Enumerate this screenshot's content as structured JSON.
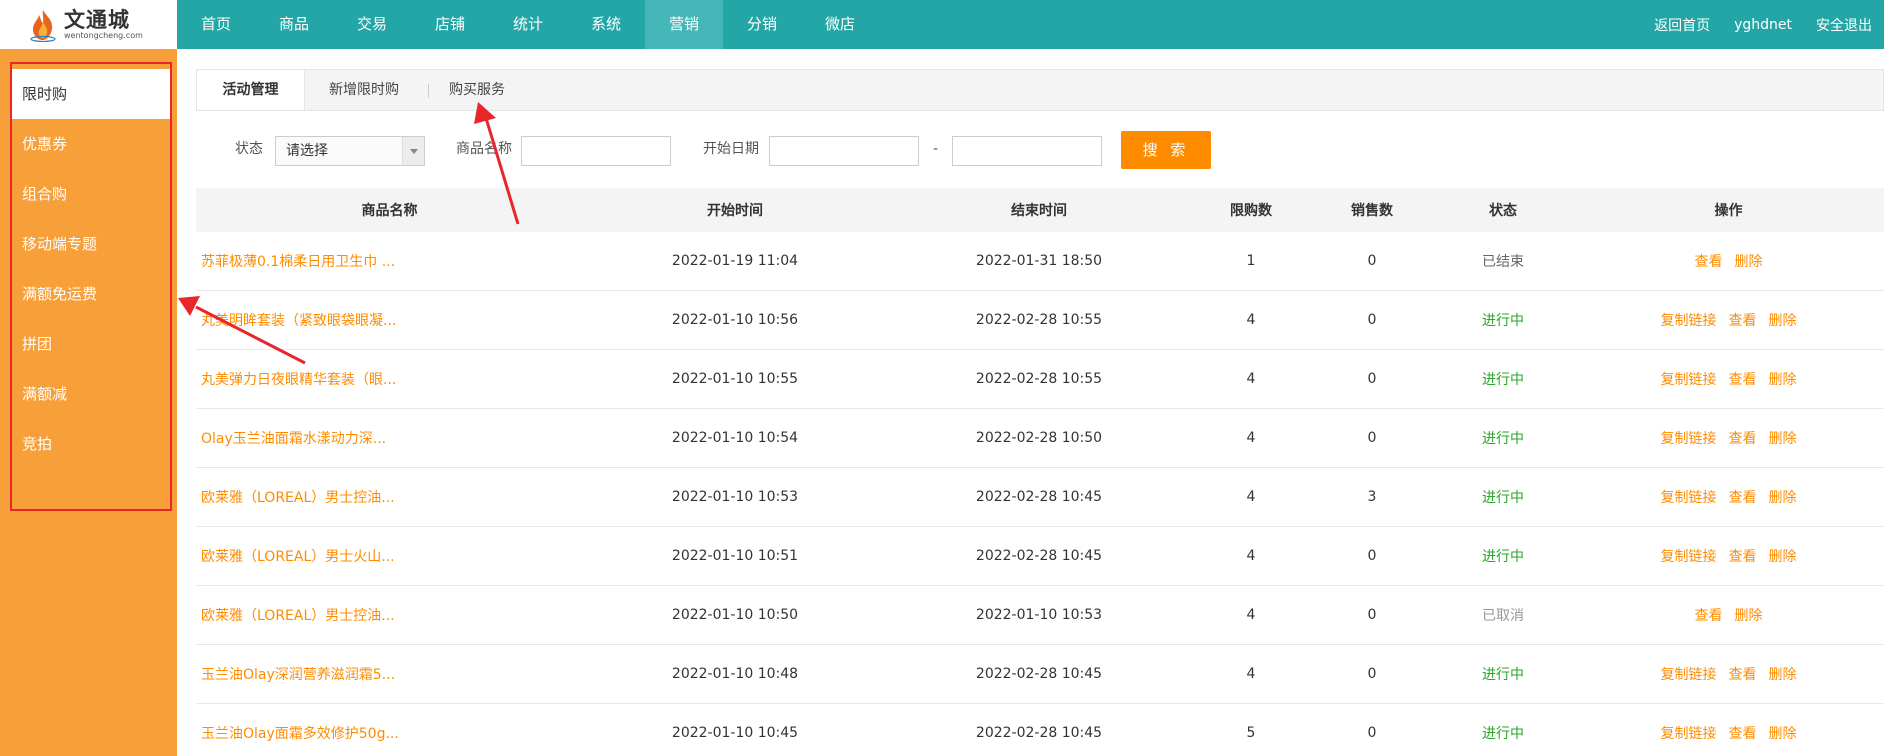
{
  "header": {
    "logo": {
      "title": "文通城",
      "subtitle": "wentongcheng.com"
    },
    "nav": [
      {
        "label": "首页",
        "active": false
      },
      {
        "label": "商品",
        "active": false
      },
      {
        "label": "交易",
        "active": false
      },
      {
        "label": "店铺",
        "active": false
      },
      {
        "label": "统计",
        "active": false
      },
      {
        "label": "系统",
        "active": false
      },
      {
        "label": "营销",
        "active": true
      },
      {
        "label": "分销",
        "active": false
      },
      {
        "label": "微店",
        "active": false
      }
    ],
    "right": {
      "home_link": "返回首页",
      "username": "yghdnet",
      "logout": "安全退出"
    }
  },
  "sidebar": {
    "items": [
      {
        "label": "限时购",
        "active": true
      },
      {
        "label": "优惠券",
        "active": false
      },
      {
        "label": "组合购",
        "active": false
      },
      {
        "label": "移动端专题",
        "active": false
      },
      {
        "label": "满额免运费",
        "active": false
      },
      {
        "label": "拼团",
        "active": false
      },
      {
        "label": "满额减",
        "active": false
      },
      {
        "label": "竞拍",
        "active": false
      }
    ]
  },
  "tabs": [
    {
      "label": "活动管理",
      "active": true
    },
    {
      "label": "新增限时购",
      "active": false
    },
    {
      "label": "购买服务",
      "active": false
    }
  ],
  "filters": {
    "status_label": "状态",
    "status_value": "请选择",
    "name_label": "商品名称",
    "name_value": "",
    "date_label": "开始日期",
    "date_from": "",
    "date_sep": "-",
    "date_to": "",
    "search_button": "搜 索"
  },
  "table": {
    "columns": {
      "name": "商品名称",
      "start": "开始时间",
      "end": "结束时间",
      "limit": "限购数",
      "sold": "销售数",
      "status": "状态",
      "ops": "操作"
    },
    "rows": [
      {
        "name": "苏菲极薄0.1棉柔日用卫生巾 ...",
        "start": "2022-01-19 11:04",
        "end": "2022-01-31 18:50",
        "limit": "1",
        "sold": "0",
        "status": "已结束",
        "status_type": "ended",
        "ops": [
          "查看",
          "删除"
        ]
      },
      {
        "name": "丸美明眸套装（紧致眼袋眼凝...",
        "start": "2022-01-10 10:56",
        "end": "2022-02-28 10:55",
        "limit": "4",
        "sold": "0",
        "status": "进行中",
        "status_type": "active",
        "ops": [
          "复制链接",
          "查看",
          "删除"
        ]
      },
      {
        "name": "丸美弹力日夜眼精华套装（眼...",
        "start": "2022-01-10 10:55",
        "end": "2022-02-28 10:55",
        "limit": "4",
        "sold": "0",
        "status": "进行中",
        "status_type": "active",
        "ops": [
          "复制链接",
          "查看",
          "删除"
        ]
      },
      {
        "name": "Olay玉兰油面霜水漾动力深...",
        "start": "2022-01-10 10:54",
        "end": "2022-02-28 10:50",
        "limit": "4",
        "sold": "0",
        "status": "进行中",
        "status_type": "active",
        "ops": [
          "复制链接",
          "查看",
          "删除"
        ]
      },
      {
        "name": "欧莱雅（LOREAL）男士控油...",
        "start": "2022-01-10 10:53",
        "end": "2022-02-28 10:45",
        "limit": "4",
        "sold": "3",
        "status": "进行中",
        "status_type": "active",
        "ops": [
          "复制链接",
          "查看",
          "删除"
        ]
      },
      {
        "name": "欧莱雅（LOREAL）男士火山...",
        "start": "2022-01-10 10:51",
        "end": "2022-02-28 10:45",
        "limit": "4",
        "sold": "0",
        "status": "进行中",
        "status_type": "active",
        "ops": [
          "复制链接",
          "查看",
          "删除"
        ]
      },
      {
        "name": "欧莱雅（LOREAL）男士控油...",
        "start": "2022-01-10 10:50",
        "end": "2022-01-10 10:53",
        "limit": "4",
        "sold": "0",
        "status": "已取消",
        "status_type": "cancel",
        "ops": [
          "查看",
          "删除"
        ]
      },
      {
        "name": "玉兰油Olay深润营养滋润霜5...",
        "start": "2022-01-10 10:48",
        "end": "2022-02-28 10:45",
        "limit": "4",
        "sold": "0",
        "status": "进行中",
        "status_type": "active",
        "ops": [
          "复制链接",
          "查看",
          "删除"
        ]
      },
      {
        "name": "玉兰油Olay面霜多效修护50g...",
        "start": "2022-01-10 10:45",
        "end": "2022-02-28 10:45",
        "limit": "5",
        "sold": "0",
        "status": "进行中",
        "status_type": "active",
        "ops": [
          "复制链接",
          "查看",
          "删除"
        ]
      }
    ]
  },
  "colors": {
    "header_bg": "#24a6a7",
    "sidebar_bg": "#f7a03a",
    "accent_orange": "#ff8c00",
    "status_active": "#2aa62a",
    "annotation_red": "#e8262b"
  }
}
